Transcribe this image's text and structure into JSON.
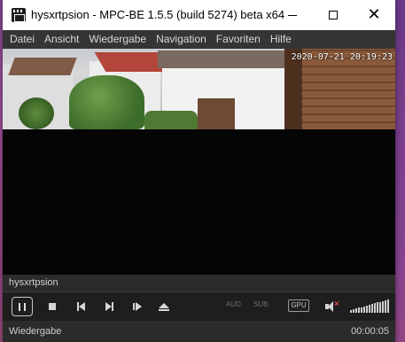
{
  "window": {
    "title": "hysxrtpsion - MPC-BE 1.5.5 (build 5274) beta x64",
    "controls": {
      "minimize_glyph": "—",
      "maximize_glyph": "☐",
      "close_glyph": "✕"
    }
  },
  "menu": {
    "items": [
      "Datei",
      "Ansicht",
      "Wiedergabe",
      "Navigation",
      "Favoriten",
      "Hilfe"
    ]
  },
  "video": {
    "timestamp": "2020-07-21 20:19:23"
  },
  "info": {
    "title": "hysxrtpsion"
  },
  "toolbar": {
    "aud_label": "AUD",
    "sub_label": "SUB",
    "gpu_label": "GPU",
    "volume_level_fraction": 1.0
  },
  "status": {
    "state": "Wiedergabe",
    "time": "00:00:05"
  },
  "colors": {
    "titlebar": "#ffffff",
    "menubar": "#353535",
    "panel": "#2b2b2b",
    "controls": "#1e1e1e",
    "mute_x": "#e04040"
  },
  "icons": {
    "app": "mpc-be-clapper-icon",
    "pause": "pause-icon",
    "stop": "stop-icon",
    "prev": "previous-icon",
    "next": "next-icon",
    "frame_step": "frame-step-icon",
    "eject": "eject-icon",
    "mute": "speaker-muted-icon"
  }
}
